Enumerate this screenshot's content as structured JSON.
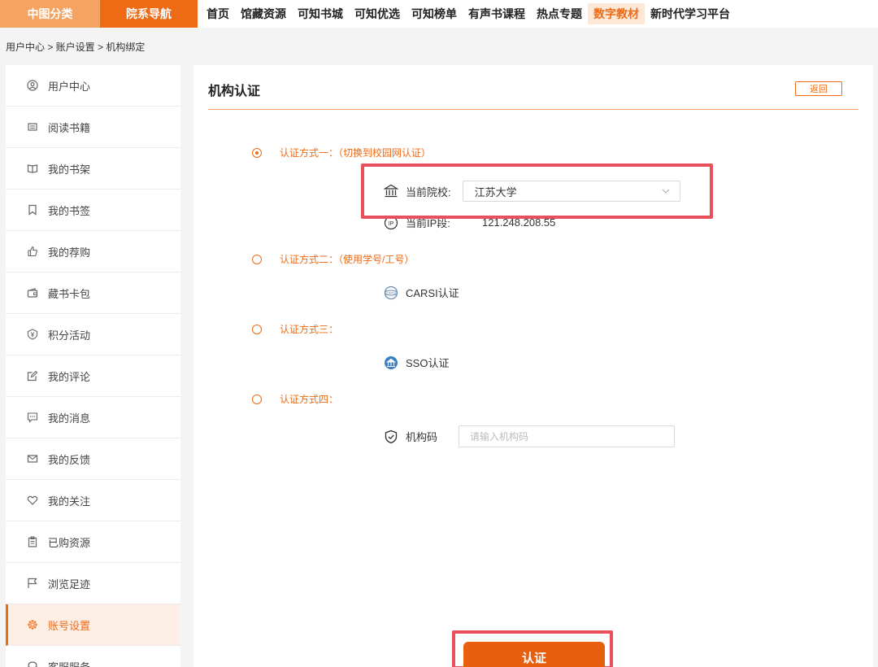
{
  "nav": {
    "category_buttons": [
      "中图分类",
      "院系导航"
    ],
    "links": [
      "首页",
      "馆藏资源",
      "可知书城",
      "可知优选",
      "可知榜单",
      "有声书课程",
      "热点专题",
      "数字教材",
      "新时代学习平台"
    ],
    "active_link": "数字教材"
  },
  "breadcrumb": "用户中心 > 账户设置 > 机构绑定",
  "sidebar": {
    "items": [
      {
        "label": "用户中心",
        "icon": "user-circle-icon"
      },
      {
        "label": "阅读书籍",
        "icon": "reading-icon"
      },
      {
        "label": "我的书架",
        "icon": "book-open-icon"
      },
      {
        "label": "我的书签",
        "icon": "bookmark-icon"
      },
      {
        "label": "我的荐购",
        "icon": "thumbs-up-icon"
      },
      {
        "label": "藏书卡包",
        "icon": "wallet-icon"
      },
      {
        "label": "积分活动",
        "icon": "points-icon"
      },
      {
        "label": "我的评论",
        "icon": "edit-icon"
      },
      {
        "label": "我的消息",
        "icon": "message-icon"
      },
      {
        "label": "我的反馈",
        "icon": "mail-icon"
      },
      {
        "label": "我的关注",
        "icon": "heart-icon"
      },
      {
        "label": "已购资源",
        "icon": "clipboard-icon"
      },
      {
        "label": "浏览足迹",
        "icon": "flag-icon"
      },
      {
        "label": "账号设置",
        "icon": "gear-icon"
      },
      {
        "label": "客服服务",
        "icon": "headset-icon"
      }
    ],
    "active": "账号设置"
  },
  "panel": {
    "title": "机构认证",
    "back_label": "返回",
    "methods": [
      {
        "label": "认证方式一：（切换到校园网认证）",
        "checked": true
      },
      {
        "label": "认证方式二：（使用学号/工号）",
        "checked": false
      },
      {
        "label": "认证方式三：",
        "checked": false
      },
      {
        "label": "认证方式四：",
        "checked": false
      }
    ],
    "school_label": "当前院校:",
    "school_value": "江苏大学",
    "ip_label": "当前IP段:",
    "ip_value": "121.248.208.55",
    "carsi_label": "CARSI认证",
    "sso_label": "SSO认证",
    "code_label": "机构码",
    "code_placeholder": "请输入机构码",
    "submit_label": "认证"
  },
  "colors": {
    "accent": "#ee6a14",
    "highlight": "#e8505b"
  }
}
